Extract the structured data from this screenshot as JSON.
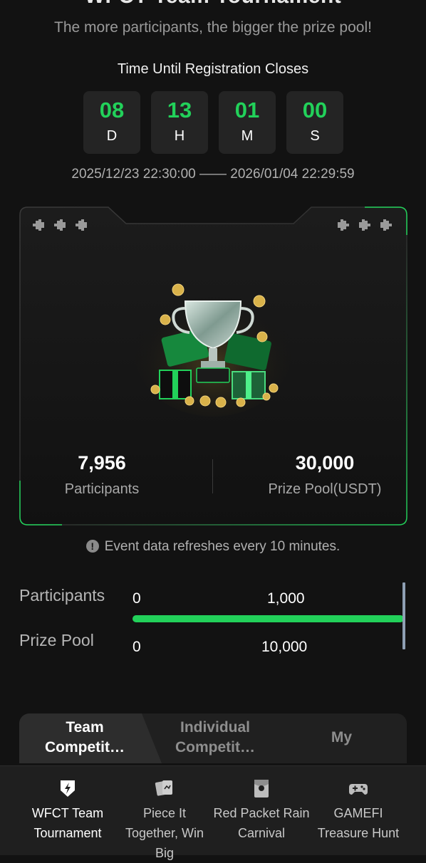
{
  "header": {
    "title": "WFCT Team Tournament",
    "subtitle": "The more participants, the bigger the prize pool!"
  },
  "countdown": {
    "label": "Time Until Registration Closes",
    "units": [
      {
        "value": "08",
        "unit": "D"
      },
      {
        "value": "13",
        "unit": "H"
      },
      {
        "value": "01",
        "unit": "M"
      },
      {
        "value": "00",
        "unit": "S"
      }
    ],
    "date_range": "2025/12/23 22:30:00 —— 2026/01/04 22:29:59"
  },
  "stats": {
    "participants_value": "7,956",
    "participants_label": "Participants",
    "prize_value": "30,000",
    "prize_label": "Prize Pool(USDT)"
  },
  "notice": {
    "icon": "info-icon",
    "text": "Event data refreshes every 10 minutes."
  },
  "progress": {
    "participants_label": "Participants",
    "participants_min": "0",
    "participants_mid": "1,000",
    "prize_label": "Prize Pool",
    "prize_min": "0",
    "prize_mid": "10,000",
    "fill_fraction": 1.0
  },
  "tabs": [
    {
      "label": "Team Competit…",
      "active": true
    },
    {
      "label": "Individual Competit…",
      "active": false
    },
    {
      "label": "My",
      "active": false
    }
  ],
  "nav": [
    {
      "label": "WFCT Team Tournament",
      "icon": "lightning-shield-icon",
      "active": true
    },
    {
      "label": "Piece It Together, Win Big",
      "icon": "cards-icon",
      "active": false
    },
    {
      "label": "Red Packet Rain Carnival",
      "icon": "red-packet-icon",
      "active": false
    },
    {
      "label": "GAMEFI Treasure Hunt",
      "icon": "gamepad-icon",
      "active": false
    }
  ],
  "colors": {
    "accent": "#22d15a",
    "background": "#121212"
  }
}
